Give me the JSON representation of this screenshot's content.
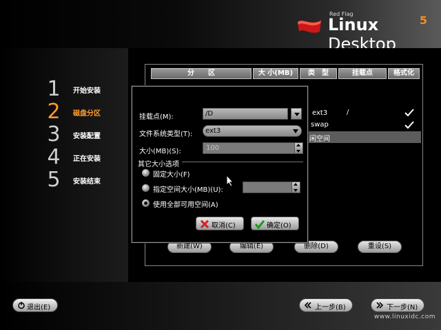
{
  "logo": {
    "small_text": "Red Flag",
    "linux": "Linux",
    "desktop": " Desktop",
    "version": "5"
  },
  "steps": [
    {
      "num": "1",
      "label": "开始安装"
    },
    {
      "num": "2",
      "label": "磁盘分区",
      "active": true
    },
    {
      "num": "3",
      "label": "安装配置"
    },
    {
      "num": "4",
      "label": "正在安装"
    },
    {
      "num": "5",
      "label": "安装结束"
    }
  ],
  "table": {
    "headers": [
      "分　　区",
      "大 小(MB)",
      "类　型",
      "挂载点",
      "格式化"
    ],
    "rows": [
      {
        "type": "ext3",
        "mount": "/",
        "format": true
      },
      {
        "type": "swap",
        "mount": "",
        "format": true
      },
      {
        "label": "闲空间",
        "selected": true
      }
    ]
  },
  "panel_buttons": {
    "new": "新建(W)",
    "edit": "编辑(E)",
    "delete": "删除(D)",
    "reset": "重设(S)"
  },
  "dialog": {
    "mount_label": "挂载点(M):",
    "mount_value": "/D",
    "fs_label": "文件系统类型(T):",
    "fs_value": "ext3",
    "size_label": "大小(MB)(S):",
    "size_value": "100",
    "group_title": "其它大小选项",
    "options": [
      {
        "label": "固定大小(F)",
        "selected": false
      },
      {
        "label": "指定空间大小(MB)(U):",
        "selected": false
      },
      {
        "label": "使用全部可用空间(A)",
        "selected": true
      }
    ],
    "cancel": "取消(C)",
    "ok": "确定(O)"
  },
  "footer": {
    "exit": "退出(E)",
    "back": "上一步(B)",
    "next": "下一步(N)",
    "watermark": "www.linuxidc.com"
  },
  "colors": {
    "accent": "#ff9b2a",
    "selection": "#5c5c5c"
  }
}
